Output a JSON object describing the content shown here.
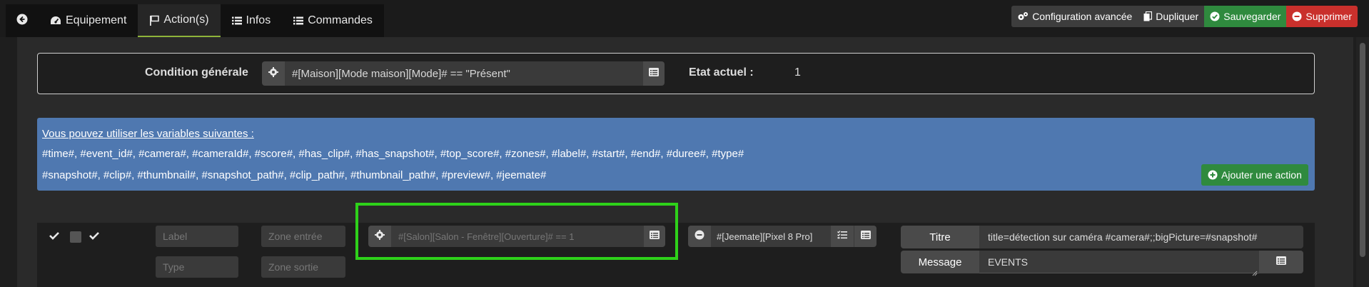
{
  "tabs": {
    "back": "",
    "equipement": "Equipement",
    "actions": "Action(s)",
    "infos": "Infos",
    "commandes": "Commandes"
  },
  "toolbar": {
    "config": "Configuration avancée",
    "dupliquer": "Dupliquer",
    "sauvegarder": "Sauvegarder",
    "supprimer": "Supprimer"
  },
  "condition": {
    "label": "Condition générale",
    "value": "#[Maison][Mode maison][Mode]# == \"Présent\"",
    "etat_label": "Etat actuel :",
    "etat_value": "1"
  },
  "info": {
    "title": "Vous pouvez utiliser les variables suivantes :",
    "vars1": "#time#, #event_id#, #camera#, #cameraId#, #score#, #has_clip#, #has_snapshot#, #top_score#, #zones#, #label#, #start#, #end#, #duree#, #type#",
    "vars2": "#snapshot#, #clip#, #thumbnail#, #snapshot_path#, #clip_path#, #thumbnail_path#, #preview#, #jeemate#",
    "add_button": "Ajouter une action"
  },
  "action_row": {
    "label_placeholder": "Label",
    "type_placeholder": "Type",
    "zone_entree_placeholder": "Zone entrée",
    "zone_sortie_placeholder": "Zone sortie",
    "condition_value": "#[Salon][Salon - Fenêtre][Ouverture]# == 1",
    "command_value": "#[Jeemate][Pixel 8 Pro]",
    "titre_label": "Titre",
    "titre_value": "title=détection sur caméra #camera#;;bigPicture=#snapshot#",
    "message_label": "Message",
    "message_value": "EVENTS"
  },
  "colors": {
    "accent_green": "#2f8a3e",
    "danger_red": "#c9302c",
    "info_blue": "#4f78b0",
    "highlight": "#2ed11a"
  }
}
